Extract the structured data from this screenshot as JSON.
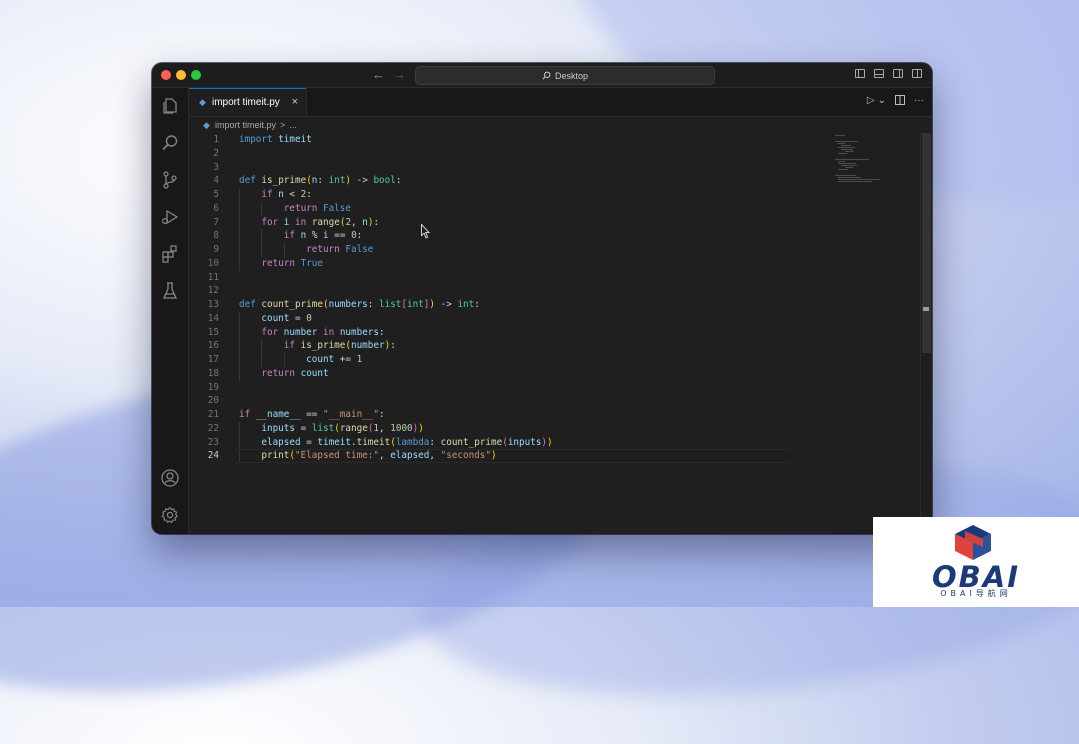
{
  "titlebar": {
    "command_center": "Desktop",
    "back_icon": "arrow-left-icon",
    "forward_icon": "arrow-right-icon",
    "layout_icons": [
      "toggle-primary-sidebar-icon",
      "toggle-panel-icon",
      "toggle-secondary-sidebar-icon",
      "customize-layout-icon"
    ]
  },
  "activity_bar": {
    "top": [
      "explorer-icon",
      "search-icon",
      "source-control-icon",
      "run-and-debug-icon",
      "extensions-icon",
      "testing-icon"
    ],
    "bottom": [
      "accounts-icon",
      "manage-gear-icon"
    ]
  },
  "tab": {
    "label": "import timeit.py",
    "close": "×"
  },
  "editor_actions": {
    "run": "▷",
    "run_menu": "⌄",
    "split": "split-editor-icon",
    "more": "···"
  },
  "breadcrumb": {
    "file": "import timeit.py",
    "separator": ">",
    "symbol": "..."
  },
  "code": {
    "line_numbers": [
      "1",
      "2",
      "3",
      "4",
      "5",
      "6",
      "7",
      "8",
      "9",
      "10",
      "11",
      "12",
      "13",
      "14",
      "15",
      "16",
      "17",
      "18",
      "19",
      "20",
      "21",
      "22",
      "23",
      "24"
    ],
    "lines": [
      "import timeit",
      "",
      "",
      "def is_prime(n: int) -> bool:",
      "    if n < 2:",
      "        return False",
      "    for i in range(2, n):",
      "        if n % i == 0:",
      "            return False",
      "    return True",
      "",
      "",
      "def count_prime(numbers: list[int]) -> int:",
      "    count = 0",
      "    for number in numbers:",
      "        if is_prime(number):",
      "            count += 1",
      "    return count",
      "",
      "",
      "if __name__ == \"__main__\":",
      "    inputs = list(range(1, 1000))",
      "    elapsed = timeit.timeit(lambda: count_prime(inputs))",
      "    print(\"Elapsed time:\", elapsed, \"seconds\")"
    ],
    "active_line": "24"
  },
  "watermark": {
    "logo_text": "OBAI",
    "subtitle": "OBAI导航网"
  },
  "colors": {
    "keyword": "#569cd6",
    "control": "#c586c0",
    "function": "#dcdcaa",
    "variable": "#9cdcfe",
    "type": "#4ec9b0",
    "number": "#b5cea8",
    "string": "#ce9178",
    "accent": "#0078d4"
  }
}
